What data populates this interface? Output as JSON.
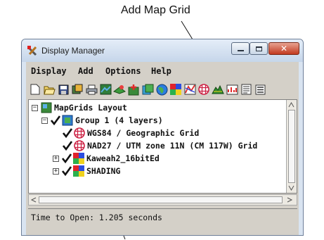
{
  "callout": {
    "label": "Add Map Grid"
  },
  "window": {
    "title": "Display Manager",
    "controls": {
      "minimize": "minimize",
      "maximize": "maximize",
      "close": "✕"
    }
  },
  "menubar": {
    "items": [
      "Display",
      "Add",
      "Options",
      "Help"
    ]
  },
  "toolbar": {
    "icons": [
      "new-icon",
      "open-icon",
      "save-icon",
      "save-as-icon",
      "print-icon",
      "view-icon",
      "add-layer-icon",
      "add-layout-icon",
      "add-group-icon",
      "add-globe-icon",
      "add-raster-icon",
      "add-vector-icon",
      "add-map-grid-icon",
      "add-terrain-icon",
      "add-chart-icon",
      "properties-icon",
      "list-icon"
    ]
  },
  "tree": {
    "items": [
      {
        "label": "MapGrids Layout",
        "type": "layout",
        "expanded": true,
        "checked": false
      },
      {
        "label": "Group 1   (4 layers)",
        "type": "group",
        "expanded": true,
        "checked": true
      },
      {
        "label": "WGS84 / Geographic Grid",
        "type": "grid",
        "checked": true
      },
      {
        "label": "NAD27 / UTM zone 11N (CM 117W) Grid",
        "type": "grid",
        "checked": true
      },
      {
        "label": "Kaweah2_16bitEd",
        "type": "raster",
        "expanded": false,
        "checked": true
      },
      {
        "label": "SHADING",
        "type": "raster",
        "expanded": false,
        "checked": true
      }
    ]
  },
  "status": {
    "text": "Time to Open: 1.205 seconds"
  },
  "colors": {
    "accent": "#c2391f",
    "client_bg": "#d4d0c8",
    "grid_icon": "#cc2244",
    "titlebar": "#c6d6ea"
  }
}
